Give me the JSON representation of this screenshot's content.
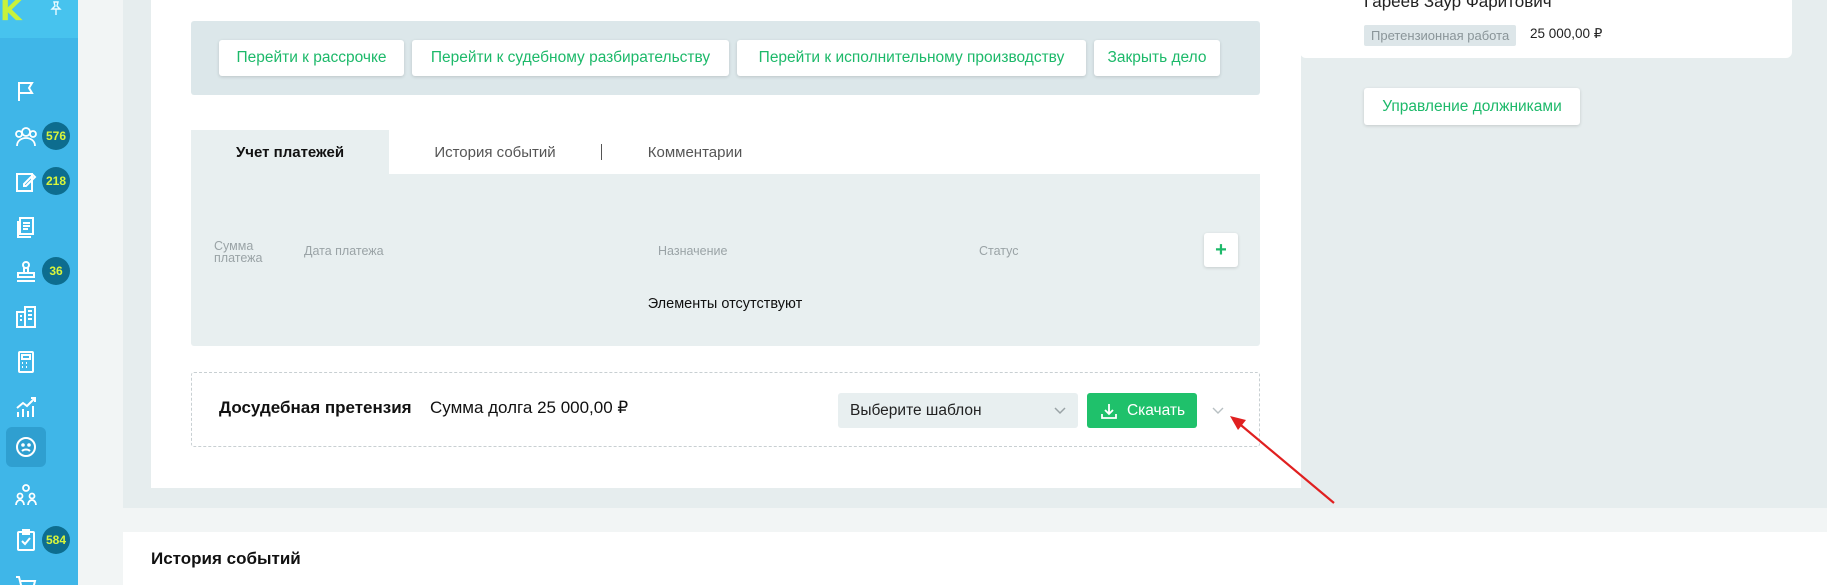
{
  "sidebar": {
    "logo_text": "K",
    "items": [
      {
        "icon": "flag-icon"
      },
      {
        "icon": "users-icon",
        "badge": "576"
      },
      {
        "icon": "edit-document-icon",
        "badge": "218"
      },
      {
        "icon": "documents-icon"
      },
      {
        "icon": "stamp-icon",
        "badge": "36"
      },
      {
        "icon": "building-icon"
      },
      {
        "icon": "calculator-icon"
      },
      {
        "icon": "chart-growth-icon"
      },
      {
        "icon": "sad-face-icon",
        "active": true
      },
      {
        "icon": "team-icon"
      },
      {
        "icon": "checklist-icon",
        "badge": "584"
      },
      {
        "icon": "cart-icon"
      }
    ]
  },
  "actions": {
    "installment": "Перейти к рассрочке",
    "court": "Перейти к судебному разбирательству",
    "enforcement": "Перейти к исполнительному производству",
    "close_case": "Закрыть дело"
  },
  "tabs": {
    "payments": "Учет платежей",
    "events": "История событий",
    "comments": "Комментарии"
  },
  "payments_table": {
    "col_sum_line1": "Сумма",
    "col_sum_line2": "платежа",
    "col_date": "Дата платежа",
    "col_purpose": "Назначение",
    "col_status": "Статус",
    "add_label": "+",
    "empty_text": "Элементы отсутствуют"
  },
  "claim": {
    "title": "Досудебная претензия",
    "debt_sum": "Сумма долга 25 000,00 ₽",
    "template_placeholder": "Выберите шаблон",
    "download_label": "Скачать"
  },
  "debtor": {
    "name": "Гареев Заур Фаритович",
    "stage_tag": "Претензионная работа",
    "amount": "25 000,00 ₽",
    "manage_label": "Управление должниками"
  },
  "history": {
    "title": "История событий"
  },
  "colors": {
    "sidebar": "#3fb6e8",
    "accent_green": "#1fc16b",
    "badge_bg": "#0d6d8f",
    "badge_text": "#d9f53b",
    "arrow": "#e02020"
  }
}
